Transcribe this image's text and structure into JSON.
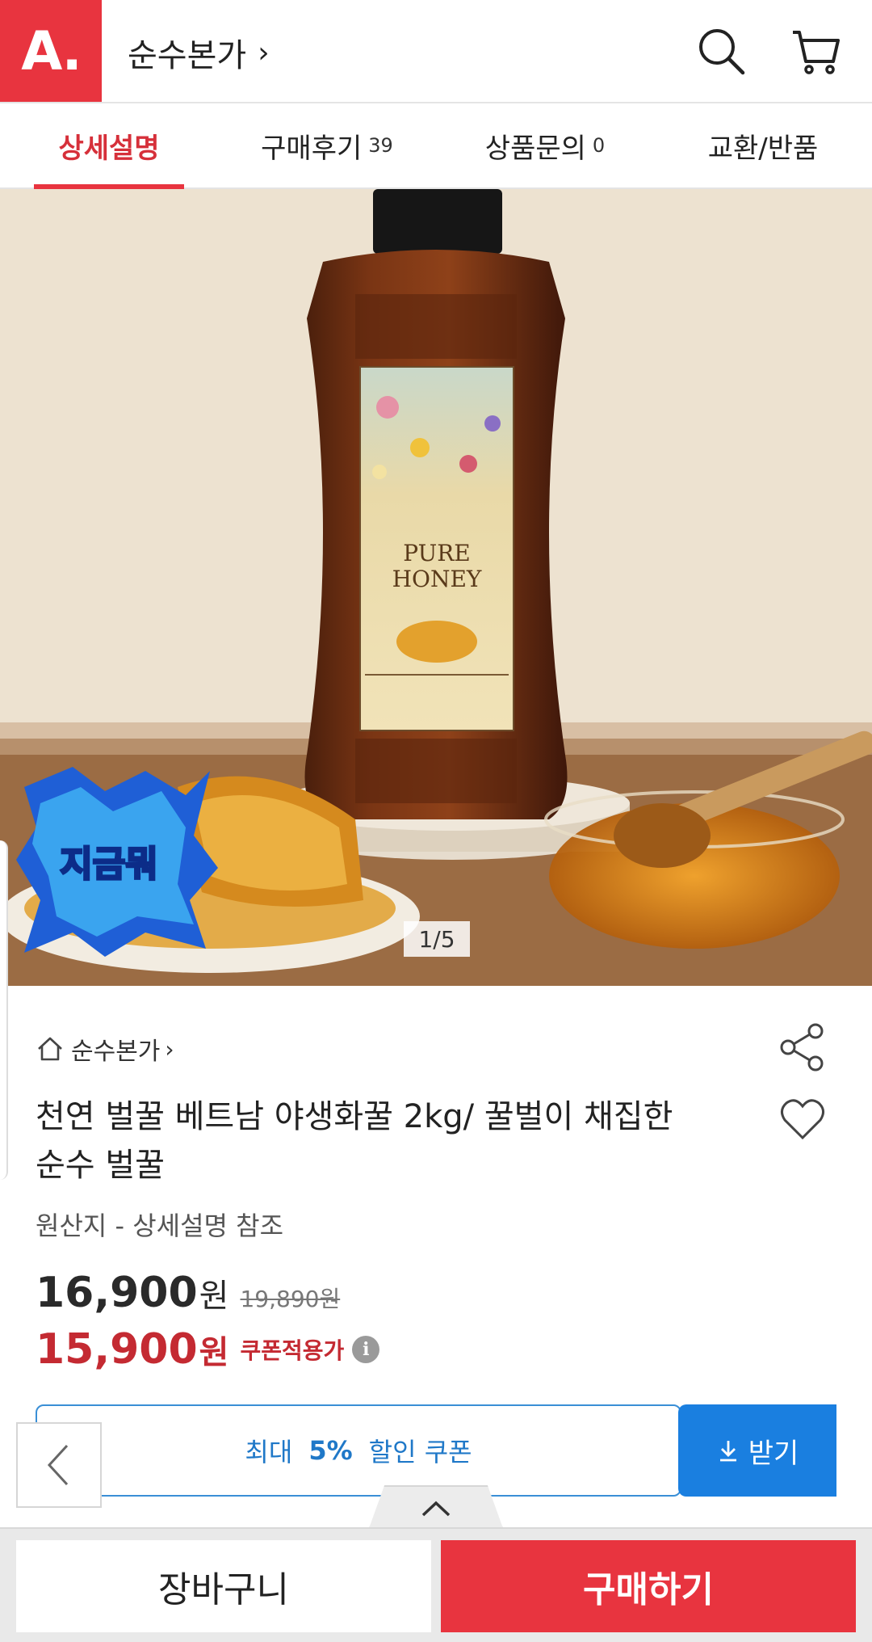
{
  "header": {
    "logo_text": "A.",
    "store_name": "순수본가",
    "store_chevron": "›",
    "icons": [
      "search-icon",
      "cart-icon"
    ],
    "accent_color": "#e8343f"
  },
  "tabs": [
    {
      "label": "상세설명",
      "count": ""
    },
    {
      "label": "구매후기",
      "count": "39"
    },
    {
      "label": "상품문의",
      "count": "0"
    },
    {
      "label": "교환/반품",
      "count": ""
    }
  ],
  "gallery": {
    "page_indicator": "1/5",
    "badge_text": "지금뭐"
  },
  "product": {
    "seller": "순수본가",
    "seller_chevron": "›",
    "title": "천연 벌꿀 베트남 야생화꿀 2kg/ 꿀벌이 채집한 순수 벌꿀",
    "origin": "원산지 - 상세설명 참조",
    "price": "16,900",
    "price_unit": "원",
    "original_price": "19,890원",
    "coupon_price": "15,900",
    "coupon_unit": "원",
    "coupon_label": "쿠폰적용가",
    "info_glyph": "i"
  },
  "coupon": {
    "prefix": "최대",
    "percent": "5%",
    "suffix": "할인 쿠폰",
    "button_label": "받기",
    "color": "#1a7fe0"
  },
  "bottom": {
    "cart_label": "장바구니",
    "buy_label": "구매하기"
  }
}
